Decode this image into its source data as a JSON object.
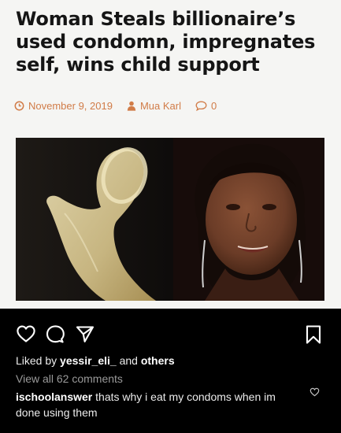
{
  "article": {
    "headline": "Woman Steals billionaire’s used condomn, impregnates self, wins child support",
    "date": "November 9, 2019",
    "author": "Mua Karl",
    "comment_count": "0"
  },
  "post": {
    "liked_by_prefix": "Liked by",
    "liked_by_user": "yessir_eli_",
    "liked_by_connector": "and",
    "liked_by_others": "others",
    "view_all_comments": "View all 62 comments",
    "comment": {
      "username": "ischoolanswer",
      "text": "thats why i eat my condoms when im done using them"
    }
  },
  "icons": {
    "clock": "clock-icon",
    "author": "user-icon",
    "comments": "comment-bubble-icon",
    "like": "heart-icon",
    "comment": "comment-icon",
    "share": "send-icon",
    "save": "bookmark-icon"
  },
  "colors": {
    "meta_accent": "#d17c48",
    "article_bg": "#f5f5f3",
    "post_bg": "#000000"
  }
}
